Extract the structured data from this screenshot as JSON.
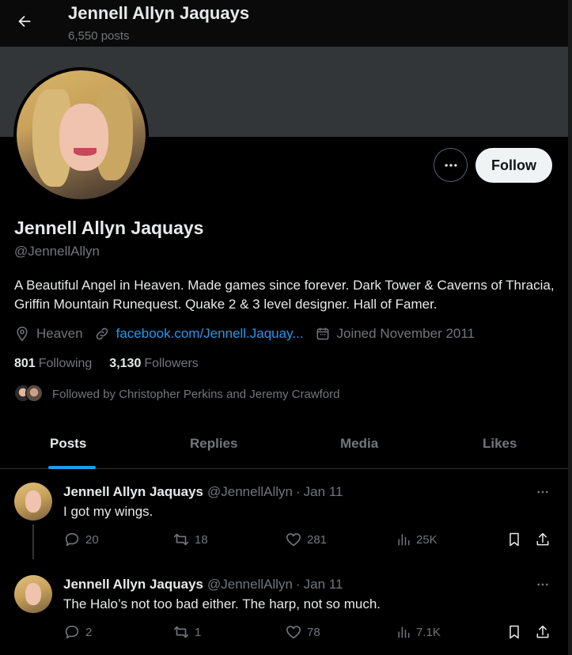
{
  "header": {
    "title": "Jennell Allyn Jaquays",
    "post_count": "6,550 posts"
  },
  "profile": {
    "name": "Jennell Allyn Jaquays",
    "handle": "@JennellAllyn",
    "bio": "A Beautiful Angel in Heaven. Made games since forever. Dark Tower & Caverns of Thracia, Griffin Mountain Runequest. Quake 2 & 3 level designer. Hall of Famer.",
    "location": "Heaven",
    "link": "facebook.com/Jennell.Jaquay...",
    "joined": "Joined November 2011",
    "following_count": "801",
    "following_label": "Following",
    "followers_count": "3,130",
    "followers_label": "Followers",
    "followed_by": "Followed by Christopher Perkins and Jeremy Crawford",
    "follow_label": "Follow"
  },
  "tabs": [
    {
      "label": "Posts"
    },
    {
      "label": "Replies"
    },
    {
      "label": "Media"
    },
    {
      "label": "Likes"
    }
  ],
  "posts": [
    {
      "name": "Jennell Allyn Jaquays",
      "handle": "@JennellAllyn",
      "separator": "·",
      "date": "Jan 11",
      "text": "I got my wings.",
      "replies": "20",
      "reposts": "18",
      "likes": "281",
      "views": "25K"
    },
    {
      "name": "Jennell Allyn Jaquays",
      "handle": "@JennellAllyn",
      "separator": "·",
      "date": "Jan 11",
      "text": "The Halo’s not too bad either. The harp, not so much.",
      "replies": "2",
      "reposts": "1",
      "likes": "78",
      "views": "7.1K"
    }
  ],
  "colors": {
    "accent": "#1d9bf0",
    "muted": "#71767b",
    "text": "#e7e9ea",
    "banner": "#333639"
  }
}
